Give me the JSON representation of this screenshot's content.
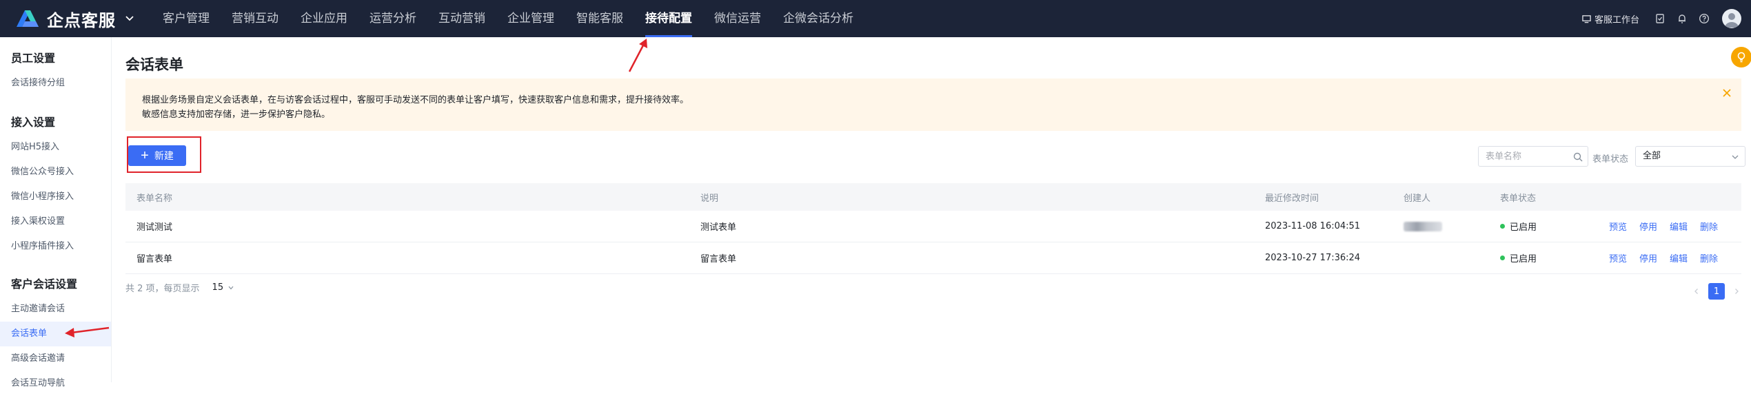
{
  "brand": {
    "name": "企点客服"
  },
  "nav": {
    "items": [
      {
        "label": "客户管理"
      },
      {
        "label": "营销互动"
      },
      {
        "label": "企业应用"
      },
      {
        "label": "运营分析"
      },
      {
        "label": "互动营销"
      },
      {
        "label": "企业管理"
      },
      {
        "label": "智能客服"
      },
      {
        "label": "接待配置",
        "active": true
      },
      {
        "label": "微信运营"
      },
      {
        "label": "企微会话分析"
      }
    ]
  },
  "topbar": {
    "workbench_label": "客服工作台"
  },
  "sidebar": {
    "groups": [
      {
        "title": "员工设置",
        "items": [
          "会话接待分组"
        ]
      },
      {
        "title": "接入设置",
        "items": [
          "网站H5接入",
          "微信公众号接入",
          "微信小程序接入",
          "接入渠权设置",
          "小程序插件接入"
        ]
      },
      {
        "title": "客户会话设置",
        "items": [
          "主动邀请会话",
          "会话表单",
          "高级会话邀请",
          "会话互动导航"
        ]
      }
    ],
    "active_item": "会话表单"
  },
  "page": {
    "title": "会话表单",
    "notice_line1": "根据业务场景自定义会话表单，在与访客会话过程中，客服可手动发送不同的表单让客户填写，快速获取客户信息和需求，提升接待效率。",
    "notice_line2": "敏感信息支持加密存储，进一步保护客户隐私。",
    "new_button": "新建",
    "search_placeholder": "表单名称",
    "status_filter_label": "表单状态",
    "status_filter_value": "全部"
  },
  "table": {
    "columns": [
      "表单名称",
      "说明",
      "最近修改时间",
      "创建人",
      "表单状态"
    ],
    "rows": [
      {
        "name": "测试测试",
        "desc": "测试表单",
        "modified": "2023-11-08 16:04:51",
        "creator_blurred": true,
        "status": "已启用"
      },
      {
        "name": "留言表单",
        "desc": "留言表单",
        "modified": "2023-10-27 17:36:24",
        "creator_blurred": false,
        "status": "已启用"
      }
    ],
    "actions": [
      "预览",
      "停用",
      "编辑",
      "删除"
    ]
  },
  "pagination": {
    "summary": "共 2 项，每页显示",
    "page_size": "15",
    "current_page": "1"
  },
  "colors": {
    "topbar": "#1c2438",
    "accent": "#3a6cf4",
    "notice_bg": "#fff6e9",
    "annotation": "#e0232a",
    "status_ok": "#2ec25b"
  }
}
